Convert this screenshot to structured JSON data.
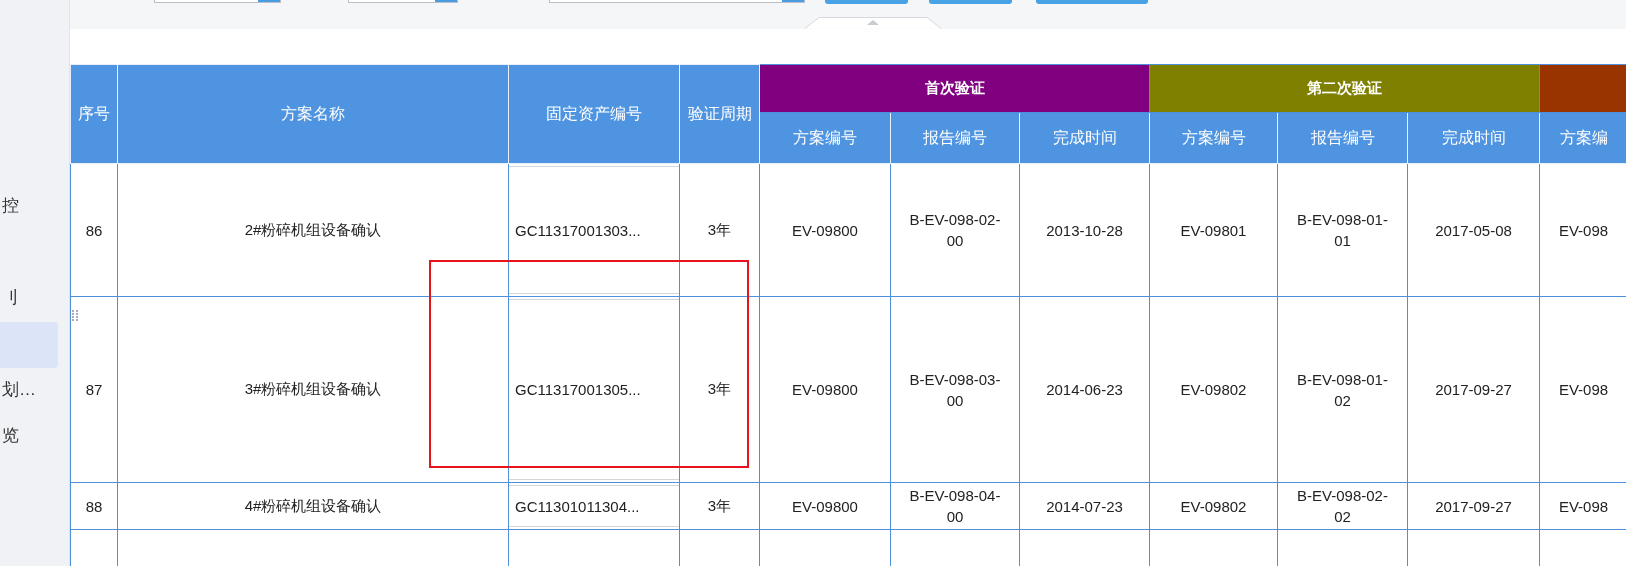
{
  "sidebar": {
    "items": [
      {
        "label": "控",
        "selected": false
      },
      {
        "label": "刂",
        "selected": false
      },
      {
        "selected": true
      },
      {
        "label": "划…",
        "selected": false
      },
      {
        "label": "览",
        "selected": false
      }
    ]
  },
  "table": {
    "columns": [
      "序号",
      "方案名称",
      "固定资产编号",
      "验证周期"
    ],
    "groups": [
      {
        "title": "首次验证",
        "color": "#800080",
        "columns": [
          "方案编号",
          "报告编号",
          "完成时间"
        ]
      },
      {
        "title": "第二次验证",
        "color": "#808000",
        "columns": [
          "方案编号",
          "报告编号",
          "完成时间"
        ]
      },
      {
        "color": "#993300",
        "columns": [
          "方案编"
        ]
      }
    ],
    "rows": [
      {
        "seq": "86",
        "name": "2#粉碎机组设备确认",
        "asset": "GC11317001303...",
        "cycle": "3年",
        "cells": [
          "EV-09800",
          "B-EV-098-02-00",
          "2013-10-28",
          "EV-09801",
          "B-EV-098-01-01",
          "2017-05-08",
          "EV-098"
        ]
      },
      {
        "seq": "87",
        "name": "3#粉碎机组设备确认",
        "asset": "GC11317001305...",
        "cycle": "3年",
        "cells": [
          "EV-09800",
          "B-EV-098-03-00",
          "2014-06-23",
          "EV-09802",
          "B-EV-098-01-02",
          "2017-09-27",
          "EV-098"
        ]
      },
      {
        "seq": "88",
        "name": "4#粉碎机组设备确认",
        "asset": "GC11301011304...",
        "cycle": "3年",
        "cells": [
          "EV-09800",
          "B-EV-098-04-00",
          "2014-07-23",
          "EV-09802",
          "B-EV-098-02-02",
          "2017-09-27",
          "EV-098"
        ]
      }
    ]
  }
}
